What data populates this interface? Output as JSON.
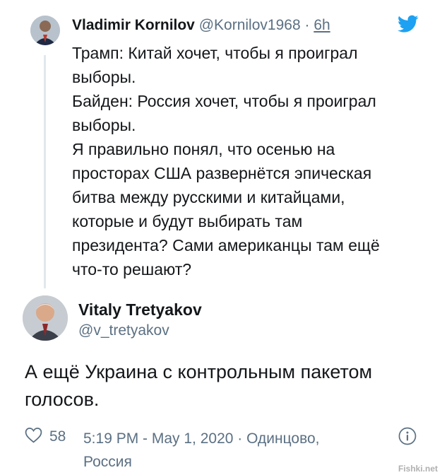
{
  "quoted": {
    "name": "Vladimir Kornilov",
    "handle": "@Kornilov1968",
    "separator": "·",
    "time": "6h",
    "lines": [
      "Трамп: Китай хочет, чтобы я проиграл",
      "выборы.",
      "Байден: Россия хочет, чтобы я проиграл",
      "выборы.",
      "Я правильно понял, что осенью на",
      "просторах США развернётся эпическая",
      "битва между русскими и китайцами,",
      "которые и будут выбирать там",
      "президента? Сами американцы там ещё",
      "что-то решают?"
    ]
  },
  "reply": {
    "name": "Vitaly Tretyakov",
    "handle": "@v_tretyakov",
    "lines": [
      "А ещё Украина с контрольным пакетом",
      "голосов."
    ]
  },
  "footer": {
    "likes": "58",
    "datetime": "5:19 PM - May 1, 2020",
    "location_sep": "·",
    "location_line1": "Одинцово,",
    "location_line2": "Россия"
  },
  "watermark": "Fishki.net",
  "colors": {
    "twitter_blue": "#1DA1F2",
    "muted": "#5b7083"
  }
}
